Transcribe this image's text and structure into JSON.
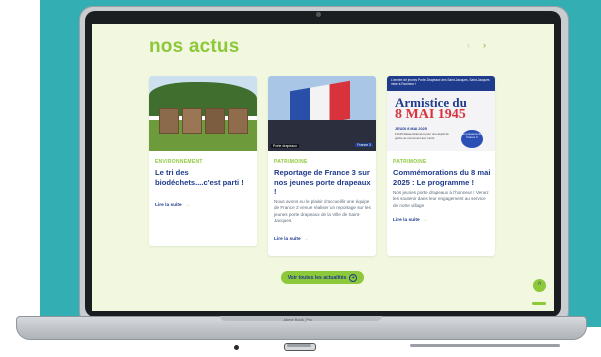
{
  "page": {
    "title": "nos actus",
    "nav_prev": "‹",
    "nav_next": "›"
  },
  "cards": [
    {
      "category": "ENVIRONNEMENT",
      "title": "Le tri des biodéchets....c'est parti !",
      "excerpt": "",
      "more_label": "Lire la suite",
      "more_arrow": "→"
    },
    {
      "category": "PATRIMOINE",
      "title": "Reportage de France 3 sur nos jeunes porte drapeaux !",
      "excerpt": "Nous avons eu le plaisir d'accueillir une équipe de France 3 venue réaliser un reportage sur les jeunes porte drapeaux de la Ville de Saint-Jacques.",
      "more_label": "Lire la suite",
      "more_arrow": "→",
      "image_caption": "Porte drapeaux",
      "image_badge": "France 3"
    },
    {
      "category": "PATRIMOINE",
      "title": "Commémorations du 8 mai 2025 : Le programme !",
      "excerpt": "Nos jeunes porte drapeaux à l'honneur ! Venez les soutenir dans leur engagement au service de notre village",
      "more_label": "Lire la suite",
      "more_arrow": "→",
      "poster": {
        "top_text": "L'armée de jeunes Porte-Drapeaux des Saint-Jacques, Saint-Jacques mise à l'honneur !",
        "line1": "Armistice du",
        "line2": "8 MAI 1945",
        "date": "JEUDI 8 MAI 2025",
        "note": "11h15 Rassemblement pour une dépôt de gerbe au monument aux morts",
        "badge": "En présence de France 3"
      }
    }
  ],
  "cta": {
    "label": "Voir toutes les actualités",
    "icon": "plus-circle-icon"
  },
  "scroll_top_icon": "chevron-up-icon",
  "laptop": {
    "brand": "Jaime Book_Pro"
  },
  "colors": {
    "background": "#33aeb2",
    "screen": "#f1f8df",
    "accent_green": "#8cc83a",
    "navy": "#1f3b8c"
  }
}
